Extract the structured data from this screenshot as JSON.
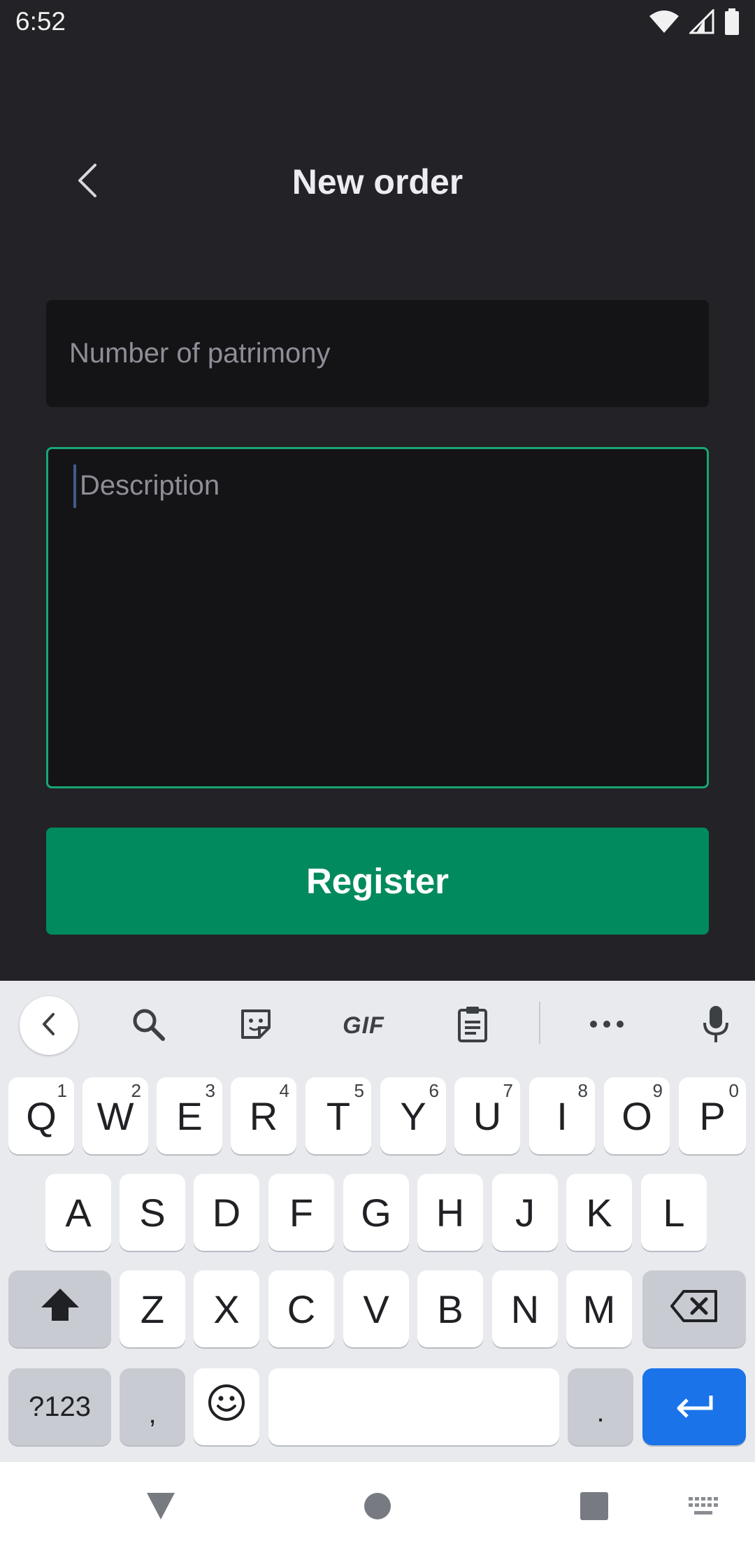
{
  "status_bar": {
    "time": "6:52"
  },
  "header": {
    "title": "New order",
    "back_icon": "chevron-left-icon"
  },
  "form": {
    "patrimony_placeholder": "Number of patrimony",
    "description_placeholder": "Description",
    "register_label": "Register"
  },
  "colors": {
    "background": "#222227",
    "field_background": "#141417",
    "accent_green": "#008a5e",
    "focus_border": "#17a673",
    "keyboard_background": "#e8eaee",
    "enter_key": "#1a73e8"
  },
  "keyboard": {
    "toolbar": {
      "gif_label": "GIF",
      "icons": [
        "chevron-left-icon",
        "search-icon",
        "sticker-icon",
        "gif-icon",
        "clipboard-icon",
        "more-icon",
        "microphone-icon"
      ]
    },
    "row1": [
      {
        "label": "Q",
        "hint": "1"
      },
      {
        "label": "W",
        "hint": "2"
      },
      {
        "label": "E",
        "hint": "3"
      },
      {
        "label": "R",
        "hint": "4"
      },
      {
        "label": "T",
        "hint": "5"
      },
      {
        "label": "Y",
        "hint": "6"
      },
      {
        "label": "U",
        "hint": "7"
      },
      {
        "label": "I",
        "hint": "8"
      },
      {
        "label": "O",
        "hint": "9"
      },
      {
        "label": "P",
        "hint": "0"
      }
    ],
    "row2": [
      "A",
      "S",
      "D",
      "F",
      "G",
      "H",
      "J",
      "K",
      "L"
    ],
    "row3": [
      "Z",
      "X",
      "C",
      "V",
      "B",
      "N",
      "M"
    ],
    "bottom": {
      "symbols_label": "?123",
      "comma_label": ",",
      "period_label": "."
    }
  }
}
